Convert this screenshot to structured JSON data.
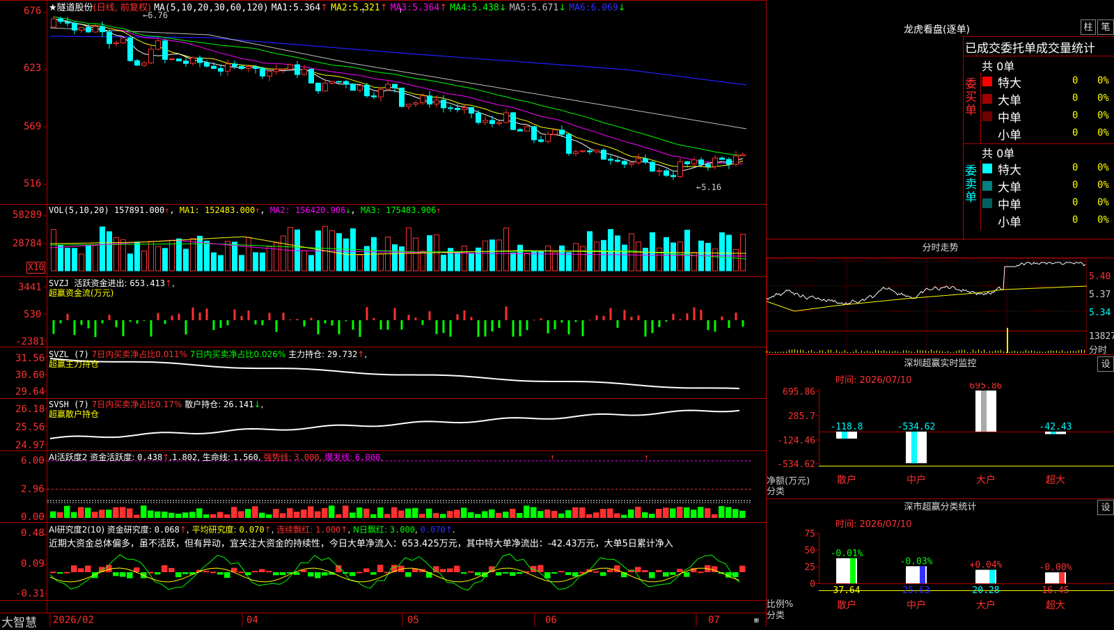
{
  "colors": {
    "up": "#ff3030",
    "down": "#00ffff",
    "green": "#00ff00",
    "ma1": "#ffffff",
    "ma2": "#ffff00",
    "ma3": "#ff00ff",
    "ma4": "#00ff00",
    "ma5": "#c0c0c0",
    "ma6": "#0000ff",
    "grid": "#b00000",
    "cyan": "#00ffff",
    "yellow": "#ffff00",
    "red": "#ff3030"
  },
  "header": {
    "star": "★",
    "name": "隧道股份",
    "period": "(日线, 前复权)",
    "ma_label": "MA(5,10,20,30,60,120)",
    "ma": [
      {
        "label": "MA1:",
        "value": "5.364"
      },
      {
        "label": "MA2:",
        "value": "5.321"
      },
      {
        "label": "MA3:",
        "value": "5.364"
      },
      {
        "label": "MA4:",
        "value": "5.438"
      },
      {
        "label": "MA5:",
        "value": "5.671"
      },
      {
        "label": "MA6:",
        "value": "6.069"
      }
    ]
  },
  "price_axis": {
    "ticks": [
      "676",
      "623",
      "569",
      "516"
    ]
  },
  "price_annot": {
    "high": "6.76",
    "low": "5.16"
  },
  "vol": {
    "label": "VOL(5,10,20)",
    "value": "157891.000",
    "ma1": "MA1: 152483.000",
    "ma2": "MA2: 156420.906",
    "ma3": "MA3: 175483.906",
    "ticks": [
      "58289",
      "28784"
    ],
    "unit": "X10"
  },
  "svzj": {
    "label": "SVZJ",
    "title": "活跃资金进出:",
    "value": "653.413",
    "sub": "超赢资金流(万元)",
    "ticks": [
      "3441",
      "530",
      "-2381"
    ]
  },
  "svzl": {
    "label": "SVZL (7)",
    "t1": "7日内买卖净占比0.011%",
    "t2": "7日内买卖净占比0.026%",
    "t3": "主力持仓:",
    "value": "29.732",
    "sub": "超赢主力持仓",
    "ticks": [
      "31.56",
      "30.60",
      "29.64"
    ]
  },
  "svsh": {
    "label": "SVSH (7)",
    "t1": "7日内买卖净占比0.17%",
    "t2": "散户持仓:",
    "value": "26.141",
    "sub": "超赢散户持仓",
    "ticks": [
      "26.18",
      "25.56",
      "24.97"
    ]
  },
  "ai1": {
    "label": "AI活跃度2",
    "t1": "资金活跃度:",
    "v1": "0.438",
    "v2": "1.802",
    "t3": "生命线:",
    "v3": "1.560",
    "t4": "强势线:",
    "v4": "3.000",
    "t5": "爆发线:",
    "v5": "6.000",
    "ticks": [
      "6.00",
      "2.96",
      "0.00"
    ]
  },
  "ai2": {
    "label": "AI研究度2(10)",
    "t1": "资金研究度:",
    "v1": "0.068",
    "t2": "平均研究度:",
    "v2": "0.070",
    "t3": "连续飘红:",
    "v3": "1.000",
    "t4": "N日飘红:",
    "v4": "3.000",
    "v5": "0.070",
    "comment": "近期大资金总体偏多，虽不活跃，但有异动，宜关注大资金的持续性，今日大单净流入：653.425万元，其中特大单净流出：-42.43万元，大单5日累计净入",
    "ticks": [
      "0.48",
      "0.09",
      "-0.31"
    ]
  },
  "dates": {
    "brand": "大智慧",
    "labels": [
      "2026/02",
      "04",
      "05",
      "06",
      "07"
    ]
  },
  "dragon": {
    "title": "龙虎看盘(逐单)",
    "btn1": "柱",
    "btn2": "笔",
    "header": "已成交委托单成交量统计",
    "buy": {
      "side": "委买单",
      "total": "共 0单",
      "rows": [
        {
          "k": "特大",
          "v": "0",
          "p": "0%"
        },
        {
          "k": "大单",
          "v": "0",
          "p": "0%"
        },
        {
          "k": "中单",
          "v": "0",
          "p": "0%"
        },
        {
          "k": "小单",
          "v": "0",
          "p": "0%"
        }
      ]
    },
    "sell": {
      "side": "委卖单",
      "total": "共 0单",
      "rows": [
        {
          "k": "特大",
          "v": "0",
          "p": "0%"
        },
        {
          "k": "大单",
          "v": "0",
          "p": "0%"
        },
        {
          "k": "中单",
          "v": "0",
          "p": "0%"
        },
        {
          "k": "小单",
          "v": "0",
          "p": "0%"
        }
      ]
    }
  },
  "intraday": {
    "title": "分时走势",
    "ticks": [
      "5.40",
      "5.37",
      "5.34"
    ],
    "vol": "13827",
    "vol_unit": "分时"
  },
  "monitor": {
    "title": "深圳超赢实时监控",
    "btn": "设",
    "time": "时间: 2026/07/10",
    "ticks": [
      "695.86",
      "285.7",
      "-124.46",
      "-534.62"
    ],
    "ylabel": "净额(万元)",
    "xlabel": "分类",
    "cats": [
      "散户",
      "中户",
      "大户",
      "超大"
    ],
    "vals": [
      "-118.8",
      "-534.62",
      "695.86",
      "-42.43"
    ]
  },
  "classify": {
    "title": "深市超赢分类统计",
    "btn": "设",
    "time": "时间: 2026/07/10",
    "ticks": [
      "75",
      "50",
      "25",
      "0"
    ],
    "ylabel": "比例%",
    "xlabel": "分类",
    "cats": [
      "散户",
      "中户",
      "大户",
      "超大"
    ],
    "pcts": [
      "-0.01%",
      "-0.03%",
      "+0.04%",
      "-0.00%"
    ],
    "vals": [
      "37.64",
      "25.63",
      "20.28",
      "16.45"
    ]
  },
  "chart_data": [
    {
      "type": "bar",
      "title": "深圳超赢实时监控",
      "categories": [
        "散户",
        "中户",
        "大户",
        "超大"
      ],
      "values": [
        -118.8,
        -534.62,
        695.86,
        -42.43
      ],
      "ylabel": "净额(万元)",
      "xlabel": "分类",
      "ylim": [
        -534.62,
        695.86
      ]
    },
    {
      "type": "bar",
      "title": "深市超赢分类统计",
      "categories": [
        "散户",
        "中户",
        "大户",
        "超大"
      ],
      "values": [
        37.64,
        25.63,
        20.28,
        16.45
      ],
      "ylabel": "比例%",
      "xlabel": "分类",
      "ylim": [
        0,
        75
      ]
    },
    {
      "type": "line",
      "title": "MA",
      "series": [
        {
          "name": "MA1",
          "values": [
            5.364
          ]
        },
        {
          "name": "MA2",
          "values": [
            5.321
          ]
        },
        {
          "name": "MA3",
          "values": [
            5.364
          ]
        },
        {
          "name": "MA4",
          "values": [
            5.438
          ]
        },
        {
          "name": "MA5",
          "values": [
            5.671
          ]
        },
        {
          "name": "MA6",
          "values": [
            6.069
          ]
        }
      ]
    }
  ]
}
